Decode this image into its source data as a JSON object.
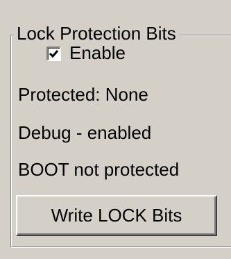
{
  "group": {
    "title": "Lock Protection Bits"
  },
  "enable_checkbox": {
    "label": "Enable",
    "checked": true
  },
  "status": {
    "protected": "Protected: None",
    "debug": "Debug - enabled",
    "boot": "BOOT not protected"
  },
  "write_button": {
    "label": "Write LOCK Bits"
  },
  "colors": {
    "background": "#d4d0c8",
    "text": "#000000",
    "checkbox_fill": "#ffffff"
  },
  "icons": {
    "checkmark": "checkmark-icon"
  }
}
